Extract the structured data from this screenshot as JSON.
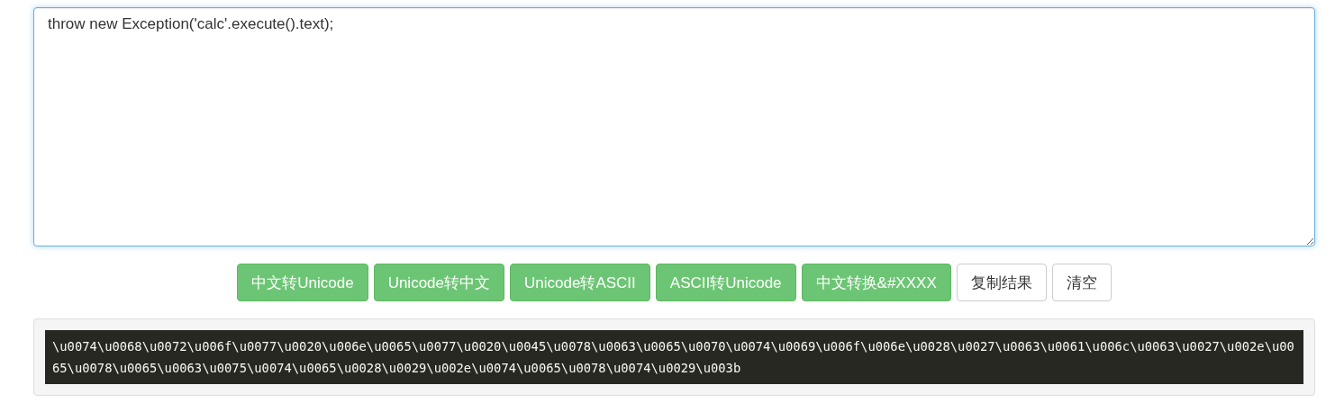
{
  "input": {
    "value": "throw new Exception('calc'.execute().text);"
  },
  "buttons": [
    {
      "label": "中文转Unicode",
      "kind": "primary"
    },
    {
      "label": "Unicode转中文",
      "kind": "primary"
    },
    {
      "label": "Unicode转ASCII",
      "kind": "primary"
    },
    {
      "label": "ASCII转Unicode",
      "kind": "primary"
    },
    {
      "label": "中文转换&#XXXX",
      "kind": "primary"
    },
    {
      "label": "复制结果",
      "kind": "default"
    },
    {
      "label": "清空",
      "kind": "default"
    }
  ],
  "output": {
    "text": "\\u0074\\u0068\\u0072\\u006f\\u0077\\u0020\\u006e\\u0065\\u0077\\u0020\\u0045\\u0078\\u0063\\u0065\\u0070\\u0074\\u0069\\u006f\\u006e\\u0028\\u0027\\u0063\\u0061\\u006c\\u0063\\u0027\\u002e\\u0065\\u0078\\u0065\\u0063\\u0075\\u0074\\u0065\\u0028\\u0029\\u002e\\u0074\\u0065\\u0078\\u0074\\u0029\\u003b"
  }
}
